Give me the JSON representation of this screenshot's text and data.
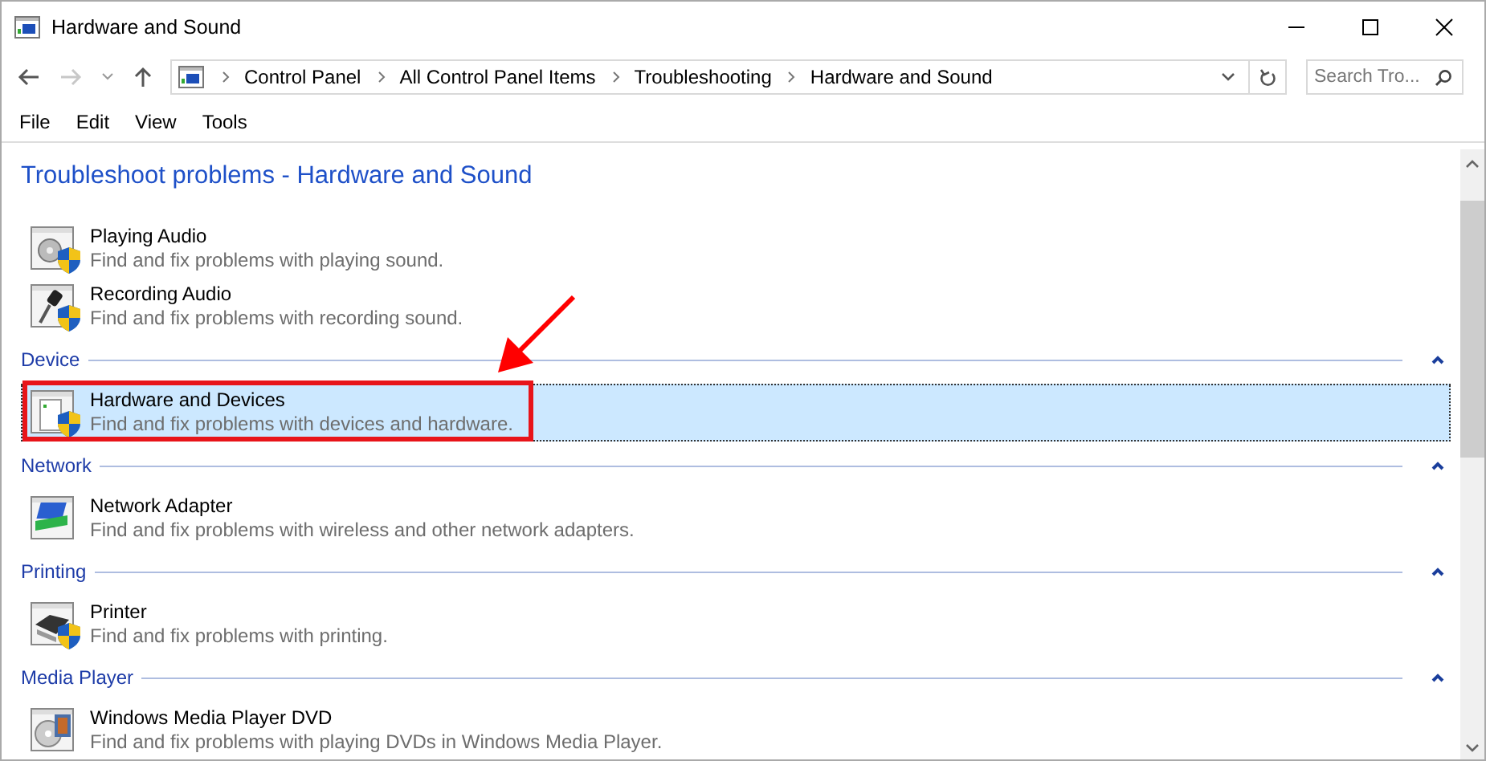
{
  "window": {
    "title": "Hardware and Sound"
  },
  "address_bar": {
    "breadcrumbs": [
      "Control Panel",
      "All Control Panel Items",
      "Troubleshooting",
      "Hardware and Sound"
    ]
  },
  "search": {
    "placeholder": "Search Tro..."
  },
  "menu": [
    "File",
    "Edit",
    "View",
    "Tools"
  ],
  "heading": "Troubleshoot problems - Hardware and Sound",
  "groups": [
    {
      "items": [
        {
          "kind": "audio",
          "title": "Playing Audio",
          "description": "Find and fix problems with playing sound.",
          "selected": false
        },
        {
          "kind": "microphone",
          "title": "Recording Audio",
          "description": "Find and fix problems with recording sound.",
          "selected": false
        }
      ]
    },
    {
      "title": "Device",
      "expanded": true,
      "items": [
        {
          "kind": "device",
          "title": "Hardware and Devices",
          "description": "Find and fix problems with devices and hardware.",
          "selected": true
        }
      ]
    },
    {
      "title": "Network",
      "expanded": true,
      "items": [
        {
          "kind": "network",
          "title": "Network Adapter",
          "description": "Find and fix problems with wireless and other network adapters.",
          "selected": false
        }
      ]
    },
    {
      "title": "Printing",
      "expanded": true,
      "items": [
        {
          "kind": "printer",
          "title": "Printer",
          "description": "Find and fix problems with printing.",
          "selected": false
        }
      ]
    },
    {
      "title": "Media Player",
      "expanded": true,
      "items": [
        {
          "kind": "dvd",
          "title": "Windows Media Player DVD",
          "description": "Find and fix problems with playing DVDs in Windows Media Player.",
          "selected": false
        }
      ]
    }
  ]
}
